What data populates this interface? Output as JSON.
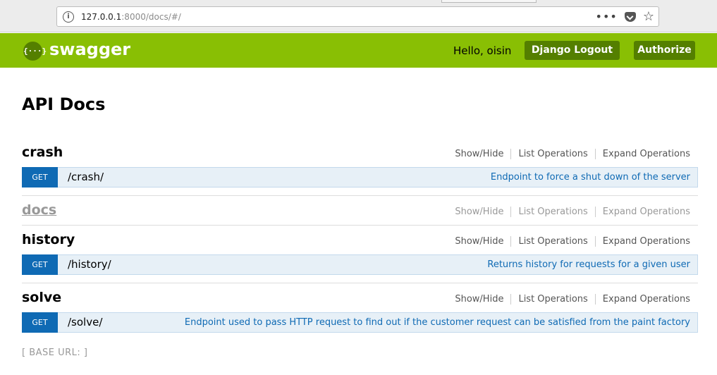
{
  "browser": {
    "info_icon": "i",
    "url_host": "127.0.0.1",
    "url_rest": ":8000/docs/#/",
    "menu_icon": "•••",
    "star_icon": "☆"
  },
  "header": {
    "logo_text": "{···}",
    "title": "swagger",
    "greeting": "Hello, oisin",
    "logout_label": "Django Logout",
    "authorize_label": "Authorize"
  },
  "page_title": "API Docs",
  "resource_links": {
    "show_hide": "Show/Hide",
    "list_operations": "List Operations",
    "expand_operations": "Expand Operations"
  },
  "resources": [
    {
      "name": "crash",
      "operations": [
        {
          "method": "GET",
          "path": "/crash/",
          "description": "Endpoint to force a shut down of the server"
        }
      ]
    },
    {
      "name": "docs",
      "operations": []
    },
    {
      "name": "history",
      "operations": [
        {
          "method": "GET",
          "path": "/history/",
          "description": "Returns history for requests for a given user"
        }
      ]
    },
    {
      "name": "solve",
      "operations": [
        {
          "method": "GET",
          "path": "/solve/",
          "description": "Endpoint used to pass HTTP request to find out if the customer request can be satisfied from the paint factory"
        }
      ]
    }
  ],
  "base_url": "[ BASE URL: ]",
  "colors": {
    "header_bg": "#89bf04",
    "button_bg": "#547f00",
    "get_method": "#0f6ab4"
  }
}
